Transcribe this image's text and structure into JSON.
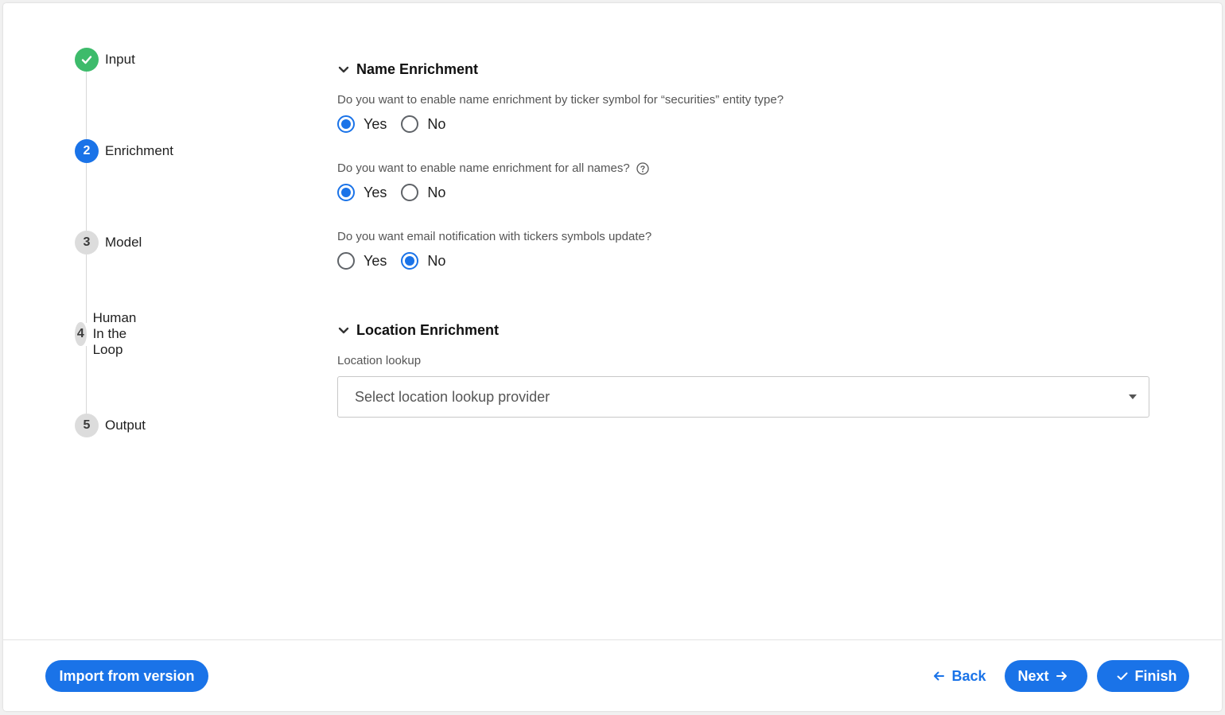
{
  "stepper": {
    "steps": [
      {
        "number": "",
        "label": "Input",
        "state": "done",
        "icon": "check-icon"
      },
      {
        "number": "2",
        "label": "Enrichment",
        "state": "active"
      },
      {
        "number": "3",
        "label": "Model",
        "state": "pending"
      },
      {
        "number": "4",
        "label": "Human In the Loop",
        "state": "pending"
      },
      {
        "number": "5",
        "label": "Output",
        "state": "pending"
      }
    ]
  },
  "name_enrichment": {
    "title": "Name Enrichment",
    "questions": [
      {
        "text": "Do you want to enable name enrichment by ticker symbol for “securities” entity type?",
        "options": [
          "Yes",
          "No"
        ],
        "selected": "Yes"
      },
      {
        "text": "Do you want to enable name enrichment for all names?",
        "options": [
          "Yes",
          "No"
        ],
        "selected": "Yes",
        "help_icon": "help-circle-icon"
      },
      {
        "text": "Do you want email notification with tickers symbols update?",
        "options": [
          "Yes",
          "No"
        ],
        "selected": "No"
      }
    ]
  },
  "location_enrichment": {
    "title": "Location Enrichment",
    "field_label": "Location lookup",
    "select_placeholder": "Select location lookup provider"
  },
  "footer": {
    "import_label": "Import from version",
    "back_label": "Back",
    "next_label": "Next",
    "finish_label": "Finish"
  },
  "colors": {
    "primary": "#1a73e8",
    "success": "#3dbb6b",
    "pending": "#dcdcdc"
  }
}
